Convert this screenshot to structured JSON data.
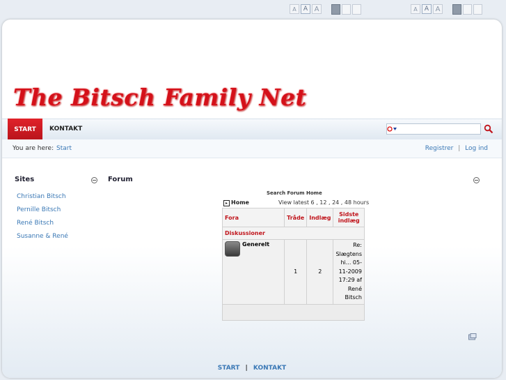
{
  "top_controls": {
    "font_small": "A",
    "font_medium": "A",
    "font_large": "A"
  },
  "site": {
    "title": "The Bitsch Family Net"
  },
  "nav": {
    "start": "START",
    "kontakt": "KONTAKT"
  },
  "breadcrumb": {
    "label": "You are here:",
    "home": "Start",
    "register": "Registrer",
    "separator": "|",
    "login": "Log ind"
  },
  "sidebar": {
    "title": "Sites",
    "items": [
      "Christian Bitsch",
      "Pernille Bitsch",
      "René Bitsch",
      "Susanne & René"
    ]
  },
  "forum": {
    "title": "Forum",
    "search_link": "Search Forum Home",
    "home": "Home",
    "view_latest": "View latest 6 , 12 , 24 , 48 hours",
    "headers": {
      "fora": "Fora",
      "traade": "Tråde",
      "indlaeg": "Indlæg",
      "sidste": "Sidste indlæg"
    },
    "category": "Diskussioner",
    "rows": [
      {
        "name": "Generelt",
        "threads": "1",
        "posts": "2",
        "last": "Re: Slægtens hi... 05-11-2009 17:29 af René Bitsch"
      }
    ]
  },
  "footer": {
    "start": "START",
    "sep": "|",
    "kontakt": "KONTAKT"
  }
}
